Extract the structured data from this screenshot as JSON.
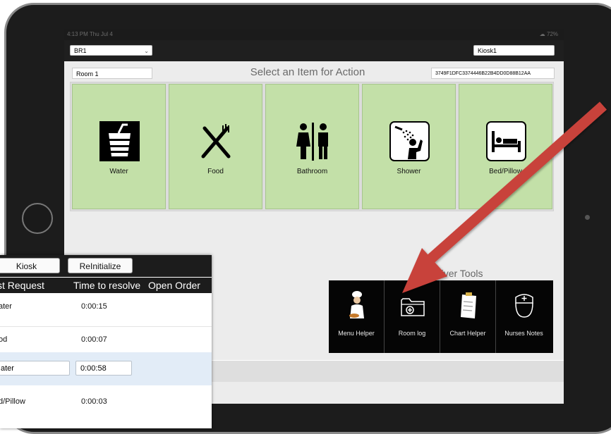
{
  "status_bar": {
    "left": "4:13 PM  Thu Jul 4",
    "right": "☁ 72%"
  },
  "top_bar": {
    "area_select": "BR1",
    "kiosk_field": "Kiosk1"
  },
  "action_header": {
    "room_field": "Room 1",
    "title": "Select an Item for Action",
    "device_id": "3749F1DFC3374446B22B4DD0D88B12AA"
  },
  "items": [
    {
      "label": "Water",
      "icon": "water-cup-icon"
    },
    {
      "label": "Food",
      "icon": "fork-knife-icon"
    },
    {
      "label": "Bathroom",
      "icon": "restroom-icon"
    },
    {
      "label": "Shower",
      "icon": "shower-icon"
    },
    {
      "label": "Bed/Pillow",
      "icon": "bed-icon"
    }
  ],
  "caregiver": {
    "title": "Caregiver Tools",
    "tools": [
      {
        "label": "Menu Helper",
        "icon": "chef-icon"
      },
      {
        "label": "Room log",
        "icon": "folder-add-icon"
      },
      {
        "label": "Chart Helper",
        "icon": "clipboard-icon"
      },
      {
        "label": "Nurses Notes",
        "icon": "nurse-cap-icon"
      }
    ]
  },
  "panel": {
    "kiosk_button": "Kiosk",
    "reinitialize_button": "ReInitialize",
    "headers": {
      "request": "st Request",
      "time": "Time to resolve",
      "open": "Open Order"
    },
    "rows": [
      {
        "request": "ater",
        "time": "0:00:15"
      },
      {
        "request": "od",
        "time": "0:00:07"
      },
      {
        "request": "ater",
        "time": "0:00:58"
      },
      {
        "request": "d/Pillow",
        "time": "0:00:03"
      }
    ]
  },
  "colors": {
    "tile": "#c3e0a8",
    "arrow": "#c8423b",
    "selected_row": "#e2ecf7"
  }
}
